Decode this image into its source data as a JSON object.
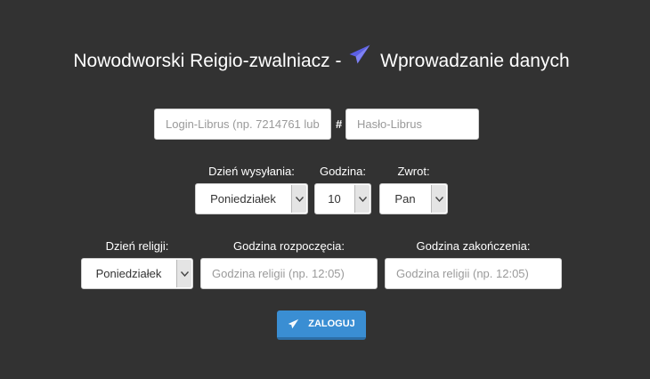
{
  "header": {
    "title_left": "Nowodworski Reigio-zwalniacz -",
    "title_right": "Wprowadzanie danych",
    "icon": "paper-plane-icon",
    "icon_color": "#6b6cf0"
  },
  "login": {
    "login_placeholder": "Login-Librus (np. 7214761 lub",
    "separator": "#",
    "password_placeholder": "Hasło-Librus"
  },
  "schedule": {
    "day_label": "Dzień wysyłania:",
    "day_value": "Poniedziałek",
    "hour_label": "Godzina:",
    "hour_value": "10",
    "title_label": "Zwrot:",
    "title_value": "Pan"
  },
  "religion": {
    "day_label": "Dzień religji:",
    "day_value": "Poniedziałek",
    "start_label": "Godzina rozpoczęcia:",
    "start_placeholder": "Godzina religii (np. 12:05)",
    "end_label": "Godzina zakończenia:",
    "end_placeholder": "Godzina religii (np. 12:05)"
  },
  "submit": {
    "label": "ZALOGUJ",
    "icon": "paper-plane-icon",
    "color": "#3a8ed3"
  },
  "colors": {
    "background": "#323232",
    "text": "#ffffff"
  }
}
